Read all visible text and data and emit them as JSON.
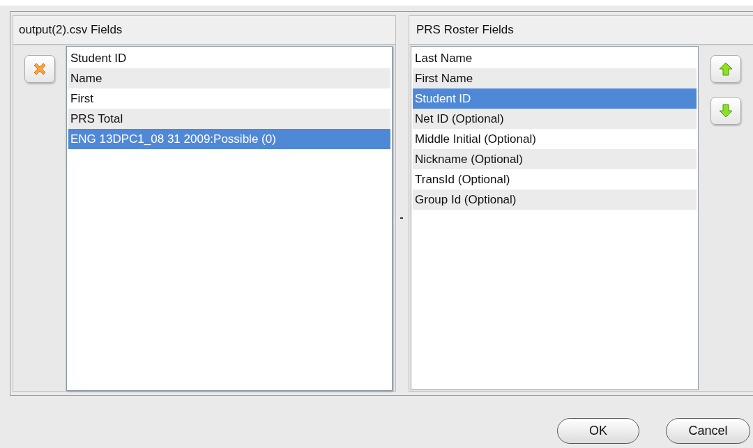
{
  "left_panel": {
    "title": "output(2).csv Fields",
    "items": [
      {
        "label": "Student ID",
        "selected": false
      },
      {
        "label": "Name",
        "selected": false
      },
      {
        "label": "First",
        "selected": false
      },
      {
        "label": "PRS Total",
        "selected": false
      },
      {
        "label": "ENG 13DPC1_08 31 2009:Possible (0)",
        "selected": true
      }
    ]
  },
  "right_panel": {
    "title": "PRS Roster Fields",
    "items": [
      {
        "label": "Last Name",
        "selected": false
      },
      {
        "label": "First Name",
        "selected": false
      },
      {
        "label": "Student ID",
        "selected": true
      },
      {
        "label": "Net ID (Optional)",
        "selected": false
      },
      {
        "label": "Middle Initial (Optional)",
        "selected": false
      },
      {
        "label": "Nickname (Optional)",
        "selected": false
      },
      {
        "label": "TransId (Optional)",
        "selected": false
      },
      {
        "label": "Group Id (Optional)",
        "selected": false
      }
    ]
  },
  "buttons": [
    "OK",
    "Cancel"
  ]
}
